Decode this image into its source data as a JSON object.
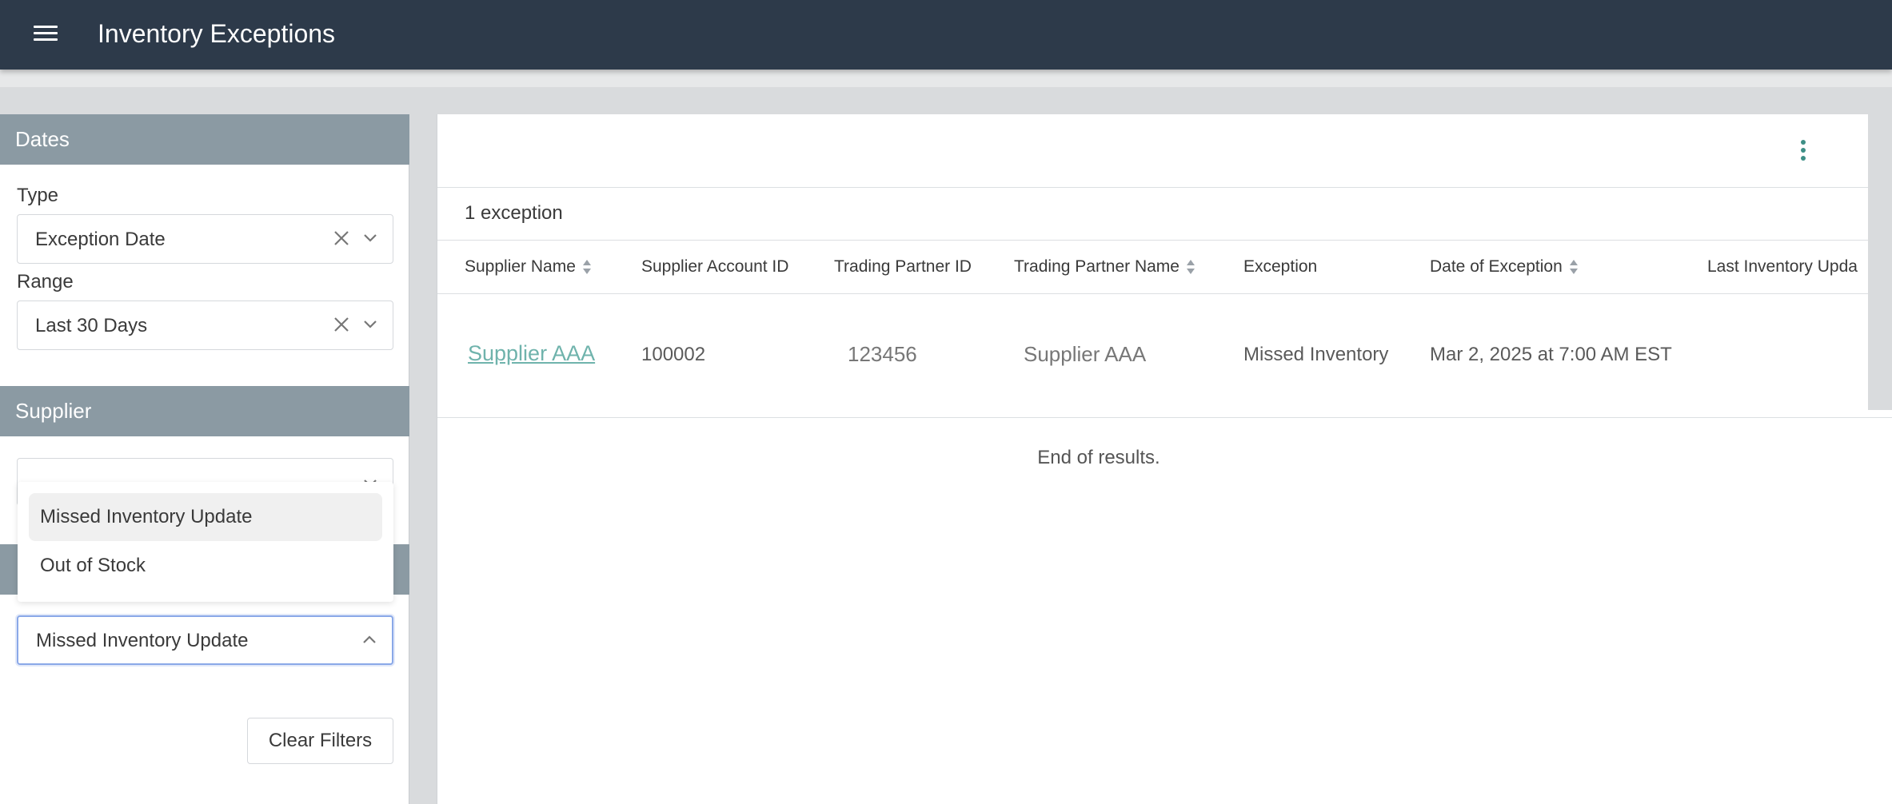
{
  "header": {
    "title": "Inventory Exceptions"
  },
  "sidebar": {
    "dates_section": "Dates",
    "type_label": "Type",
    "type_value": "Exception Date",
    "range_label": "Range",
    "range_value": "Last 30 Days",
    "supplier_section": "Supplier",
    "supplier_value": "",
    "exception_select_value": "Missed Inventory Update",
    "exception_options": [
      "Missed Inventory Update",
      "Out of Stock"
    ],
    "clear_filters_label": "Clear Filters"
  },
  "main": {
    "count_text": "1 exception",
    "columns": [
      "Supplier Name",
      "Supplier Account ID",
      "Trading Partner ID",
      "Trading Partner Name",
      "Exception",
      "Date of Exception",
      "Last Inventory Upda"
    ],
    "rows": [
      {
        "supplier_name": "Supplier AAA",
        "supplier_account_id": "100002",
        "trading_partner_id": "123456",
        "trading_partner_name": "Supplier AAA",
        "exception": "Missed Inventory",
        "date_of_exception": "Mar 2, 2025 at 7:00 AM EST",
        "last_inventory_update": ""
      }
    ],
    "end_text": "End of results."
  },
  "colors": {
    "topbar": "#2d3a4a",
    "section_header": "#8b9aa3",
    "link": "#6fb3ac",
    "accent": "#3d8f86"
  }
}
